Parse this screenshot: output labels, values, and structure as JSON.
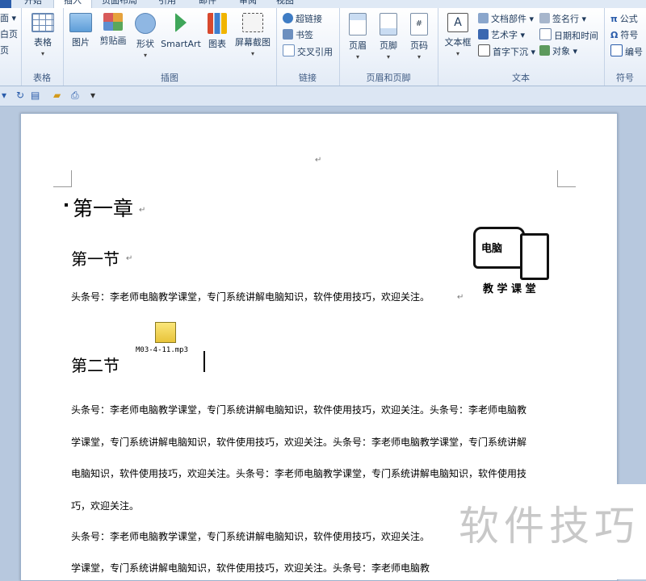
{
  "tabs": [
    "开始",
    "插入",
    "页面布局",
    "引用",
    "邮件",
    "审阅",
    "视图"
  ],
  "left_edge": {
    "item1": "面 ▾",
    "item2": "白页",
    "item3": "页"
  },
  "ribbon": {
    "table_group": {
      "label": "表格",
      "table_btn": "表格"
    },
    "illustrations_group": {
      "label": "插图",
      "picture": "图片",
      "clipart": "剪贴画",
      "shapes": "形状",
      "smartart": "SmartArt",
      "chart": "图表",
      "screenshot": "屏幕截图"
    },
    "links_group": {
      "label": "链接",
      "hyperlink": "超链接",
      "bookmark": "书签",
      "crossref": "交叉引用"
    },
    "header_footer_group": {
      "label": "页眉和页脚",
      "header": "页眉",
      "footer": "页脚",
      "page_number": "页码"
    },
    "text_group": {
      "label": "文本",
      "textbox": "文本框",
      "quickparts": "文档部件 ▾",
      "wordart": "艺术字 ▾",
      "dropcap": "首字下沉 ▾",
      "signature": "签名行 ▾",
      "datetime": "日期和时间",
      "object": "对象 ▾"
    },
    "symbols_group": {
      "label": "符号",
      "equation": "公式",
      "symbol": "符号",
      "numbering": "编号"
    }
  },
  "document": {
    "chapter": "第一章",
    "section1": "第一节",
    "section2": "第二节",
    "para1": "头条号：李老师电脑教学课堂，专门系统讲解电脑知识，软件使用技巧，欢迎关注。",
    "para2_lines": [
      "头条号：李老师电脑教学课堂，专门系统讲解电脑知识，软件使用技巧，欢迎关注。头条号：李老师电脑教",
      "学课堂，专门系统讲解电脑知识，软件使用技巧，欢迎关注。头条号：李老师电脑教学课堂，专门系统讲解",
      "电脑知识，软件使用技巧，欢迎关注。头条号：李老师电脑教学课堂，专门系统讲解电脑知识，软件使用技",
      "巧，欢迎关注。"
    ],
    "para3": "头条号：李老师电脑教学课堂，专门系统讲解电脑知识，软件使用技巧，欢迎关注。",
    "para4": "学课堂，专门系统讲解电脑知识，软件使用技巧，欢迎关注。头条号：李老师电脑教",
    "embedded_file": "M03-4-11.mp3",
    "logo_top": "电脑",
    "logo_bottom": "教 学 课 堂"
  },
  "watermark": "软件技巧",
  "colors": {
    "ribbon_bg": "#eef3fa",
    "tab_file": "#2a5caa",
    "workspace": "#b7c8de"
  }
}
